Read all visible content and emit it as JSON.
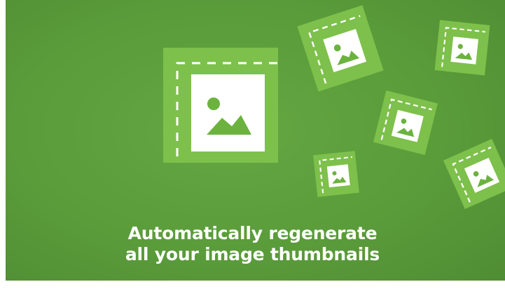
{
  "tagline": {
    "line1": "Automatically regenerate",
    "line2": "all your image thumbnails"
  },
  "colors": {
    "background": "#5a9b3a",
    "tile": "#7dc04b",
    "tile_shadow": "#4c8a30",
    "frame": "#ffffff",
    "picture_icon": "#6bb33e"
  },
  "icons": [
    "image-thumbnail-icon",
    "image-thumbnail-icon",
    "image-thumbnail-icon",
    "image-thumbnail-icon",
    "image-thumbnail-icon",
    "image-thumbnail-icon"
  ]
}
